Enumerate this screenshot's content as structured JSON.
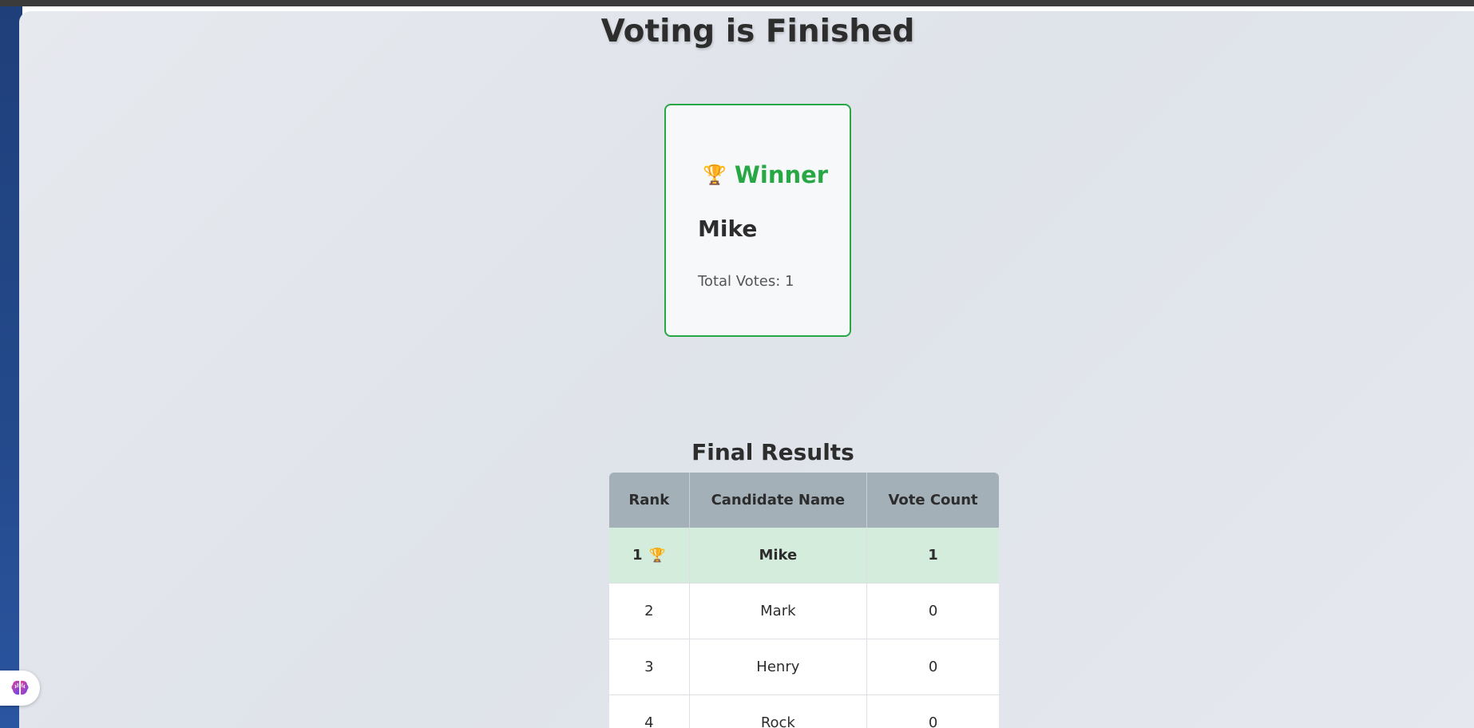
{
  "page": {
    "title": "Voting is Finished"
  },
  "winner": {
    "icon": "trophy-icon",
    "heading": "Winner",
    "name": "Mike",
    "votes_text": "Total Votes: 1",
    "accent_color": "#28a745"
  },
  "results": {
    "title": "Final Results",
    "columns": [
      "Rank",
      "Candidate Name",
      "Vote Count"
    ],
    "rows": [
      {
        "rank": "1",
        "name": "Mike",
        "votes": "1",
        "is_winner": true
      },
      {
        "rank": "2",
        "name": "Mark",
        "votes": "0",
        "is_winner": false
      },
      {
        "rank": "3",
        "name": "Henry",
        "votes": "0",
        "is_winner": false
      },
      {
        "rank": "4",
        "name": "Rock",
        "votes": "0",
        "is_winner": false
      }
    ]
  },
  "widgets": {
    "assistant_icon": "brain-icon"
  }
}
